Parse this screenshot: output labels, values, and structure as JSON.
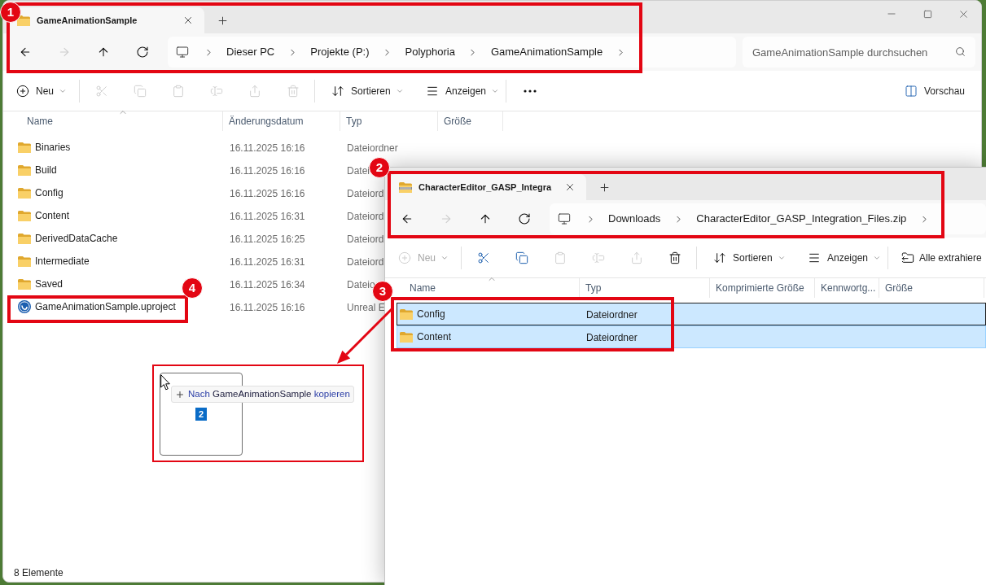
{
  "main_window": {
    "tabs": [
      {
        "kind": "folder",
        "label": "GameAnimationSample",
        "selected": true
      }
    ],
    "nav": [
      {
        "kind": "back",
        "disabled": false
      },
      {
        "kind": "forward",
        "disabled": true
      },
      {
        "kind": "up",
        "disabled": false
      },
      {
        "kind": "refresh",
        "disabled": false
      }
    ],
    "breadcrumb": [
      "Dieser PC",
      "Projekte (P:)",
      "Polyphoria",
      "GameAnimationSample"
    ],
    "search": {
      "placeholder": "GameAnimationSample durchsuchen"
    },
    "toolbar": [
      {
        "kind": "new",
        "label": "Neu",
        "disabled": false
      },
      {
        "kind": "cut",
        "disabled": true
      },
      {
        "kind": "copy",
        "disabled": true
      },
      {
        "kind": "paste",
        "disabled": true
      },
      {
        "kind": "rename",
        "disabled": true
      },
      {
        "kind": "share",
        "disabled": true
      },
      {
        "kind": "delete",
        "disabled": true
      },
      {
        "kind": "sort",
        "label": "Sortieren",
        "disabled": false
      },
      {
        "kind": "view",
        "label": "Anzeigen",
        "disabled": false
      },
      {
        "kind": "more",
        "disabled": false
      }
    ],
    "preview": {
      "label": "Vorschau"
    },
    "columns": [
      {
        "label": "Name",
        "sorted": true
      },
      {
        "label": "Änderungsdatum",
        "sorted": false
      },
      {
        "label": "Typ",
        "sorted": false
      },
      {
        "label": "Größe",
        "sorted": false
      }
    ],
    "rows": [
      {
        "kind": "folder",
        "name": "Binaries",
        "date": "16.11.2025 16:16",
        "type": "Dateiordner"
      },
      {
        "kind": "folder",
        "name": "Build",
        "date": "16.11.2025 16:16",
        "type": "Datei"
      },
      {
        "kind": "folder",
        "name": "Config",
        "date": "16.11.2025 16:16",
        "type": "Dateiord"
      },
      {
        "kind": "folder",
        "name": "Content",
        "date": "16.11.2025 16:31",
        "type": "Dateiord"
      },
      {
        "kind": "folder",
        "name": "DerivedDataCache",
        "date": "16.11.2025 16:25",
        "type": "Dateiord"
      },
      {
        "kind": "folder",
        "name": "Intermediate",
        "date": "16.11.2025 16:31",
        "type": "Dateiord"
      },
      {
        "kind": "folder",
        "name": "Saved",
        "date": "16.11.2025 16:34",
        "type": "Dateio"
      },
      {
        "kind": "project",
        "name": "GameAnimationSample.uproject",
        "date": "16.11.2025 16:16",
        "type": "Unreal E"
      }
    ],
    "status_bar": "8 Elemente"
  },
  "zip_window": {
    "tabs": [
      {
        "kind": "zip",
        "label": "CharacterEditor_GASP_Integra",
        "selected": true
      }
    ],
    "nav": [
      {
        "kind": "back",
        "disabled": false
      },
      {
        "kind": "forward",
        "disabled": true
      },
      {
        "kind": "up",
        "disabled": false
      },
      {
        "kind": "refresh",
        "disabled": false
      }
    ],
    "breadcrumb": [
      "Downloads",
      "CharacterEditor_GASP_Integration_Files.zip"
    ],
    "toolbar": [
      {
        "kind": "new",
        "label": "Neu",
        "disabled": true
      },
      {
        "kind": "cut",
        "disabled": false
      },
      {
        "kind": "copy",
        "disabled": false
      },
      {
        "kind": "paste",
        "disabled": true
      },
      {
        "kind": "rename",
        "disabled": true
      },
      {
        "kind": "share",
        "disabled": true
      },
      {
        "kind": "delete",
        "disabled": false
      },
      {
        "kind": "sort",
        "label": "Sortieren",
        "disabled": false
      },
      {
        "kind": "view",
        "label": "Anzeigen",
        "disabled": false
      },
      {
        "kind": "extract",
        "label": "Alle extrahiere",
        "disabled": false
      }
    ],
    "columns": [
      {
        "label": "Name",
        "sorted": true
      },
      {
        "label": "Typ",
        "sorted": false
      },
      {
        "label": "Komprimierte Größe",
        "sorted": false
      },
      {
        "label": "Kennwortg...",
        "sorted": false
      },
      {
        "label": "Größe",
        "sorted": false
      }
    ],
    "rows": [
      {
        "kind": "folder",
        "name": "Config",
        "type": "Dateiordner",
        "selected": true,
        "focused": true
      },
      {
        "kind": "folder",
        "name": "Content",
        "type": "Dateiordner",
        "selected": true,
        "focused": false
      }
    ]
  },
  "drag": {
    "before": "Nach",
    "target": "GameAnimationSample",
    "after": "kopieren",
    "count": "2"
  },
  "annotations": [
    {
      "label": "1"
    },
    {
      "label": "2"
    },
    {
      "label": "3"
    },
    {
      "label": "4"
    }
  ]
}
